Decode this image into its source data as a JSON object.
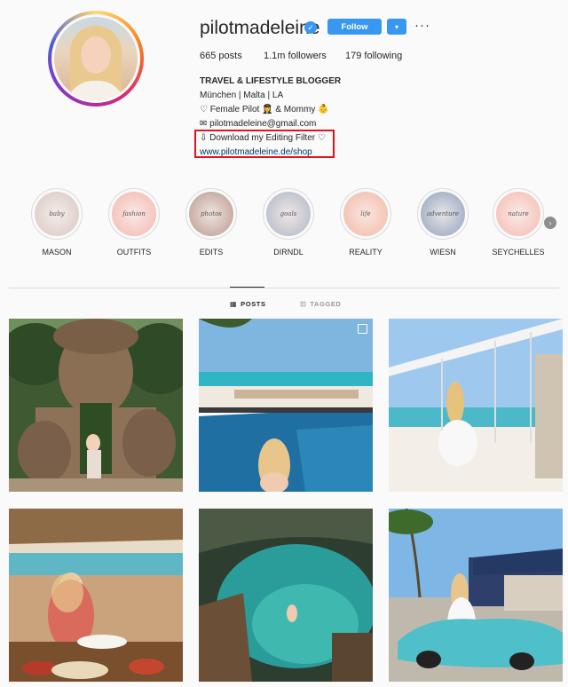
{
  "profile": {
    "username": "pilotmadeleine",
    "follow_label": "Follow",
    "dropdown_icon": "▾",
    "more_icon": "···",
    "verified_icon": "✓"
  },
  "stats": {
    "posts": "665",
    "posts_label": "posts",
    "followers": "1.1m",
    "followers_label": "followers",
    "following": "179",
    "following_label": "following"
  },
  "bio": {
    "name": "TRAVEL & LIFESTYLE BLOGGER",
    "line1": "München | Malta | LA",
    "line2": "♡ Female Pilot 👩‍✈️ & Mommy 👶",
    "line3": "✉ pilotmadeleine@gmail.com",
    "line4": "⇩ Download my Editing Filter ♡",
    "link": "www.pilotmadeleine.de/shop"
  },
  "highlights": [
    {
      "label": "MASON",
      "script": "baby"
    },
    {
      "label": "OUTFITS",
      "script": "fashion"
    },
    {
      "label": "EDITS",
      "script": "photos"
    },
    {
      "label": "DIRNDL",
      "script": "goals"
    },
    {
      "label": "REALITY",
      "script": "life"
    },
    {
      "label": "WIESN",
      "script": "adventure"
    },
    {
      "label": "SEYCHELLES",
      "script": "nature"
    }
  ],
  "highlights_next_icon": "›",
  "tabs": {
    "posts": "POSTS",
    "tagged": "TAGGED",
    "posts_icon": "▦",
    "tagged_icon": "⊡"
  },
  "colors": {
    "accent": "#3897f0",
    "highlight_box": "#e0141e",
    "link": "#003569"
  }
}
